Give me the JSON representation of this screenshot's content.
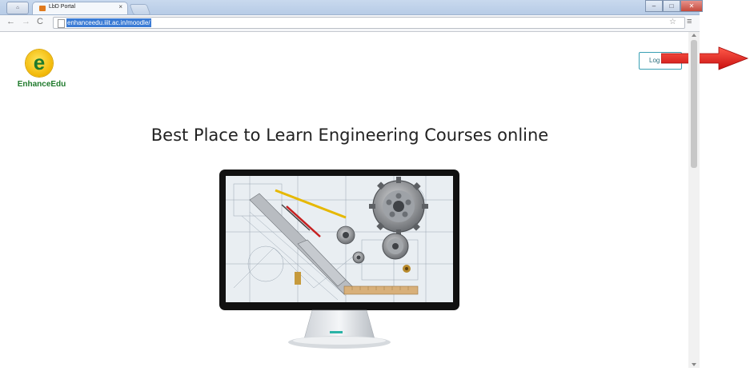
{
  "browser": {
    "tab_title": "LbD Portal",
    "tab_close": "×",
    "url": "enhanceedu.iiit.ac.in/moodle/",
    "win_min": "–",
    "win_max": "□",
    "win_close": "✕",
    "icons": [
      "back-icon",
      "forward-icon",
      "reload-icon",
      "page-icon",
      "star-icon",
      "menu-icon"
    ]
  },
  "page": {
    "logo_text": "EnhanceEdu",
    "logo_letter": "e",
    "login_label": "Log",
    "headline": "Best Place to Learn Engineering Courses online"
  },
  "colors": {
    "brand_green": "#1f7a2c",
    "logo_yellow": "#f2b705",
    "login_border": "#3aa0b4",
    "annotation_arrow": "#e01a1a",
    "url_highlight": "#3a7bd5"
  }
}
